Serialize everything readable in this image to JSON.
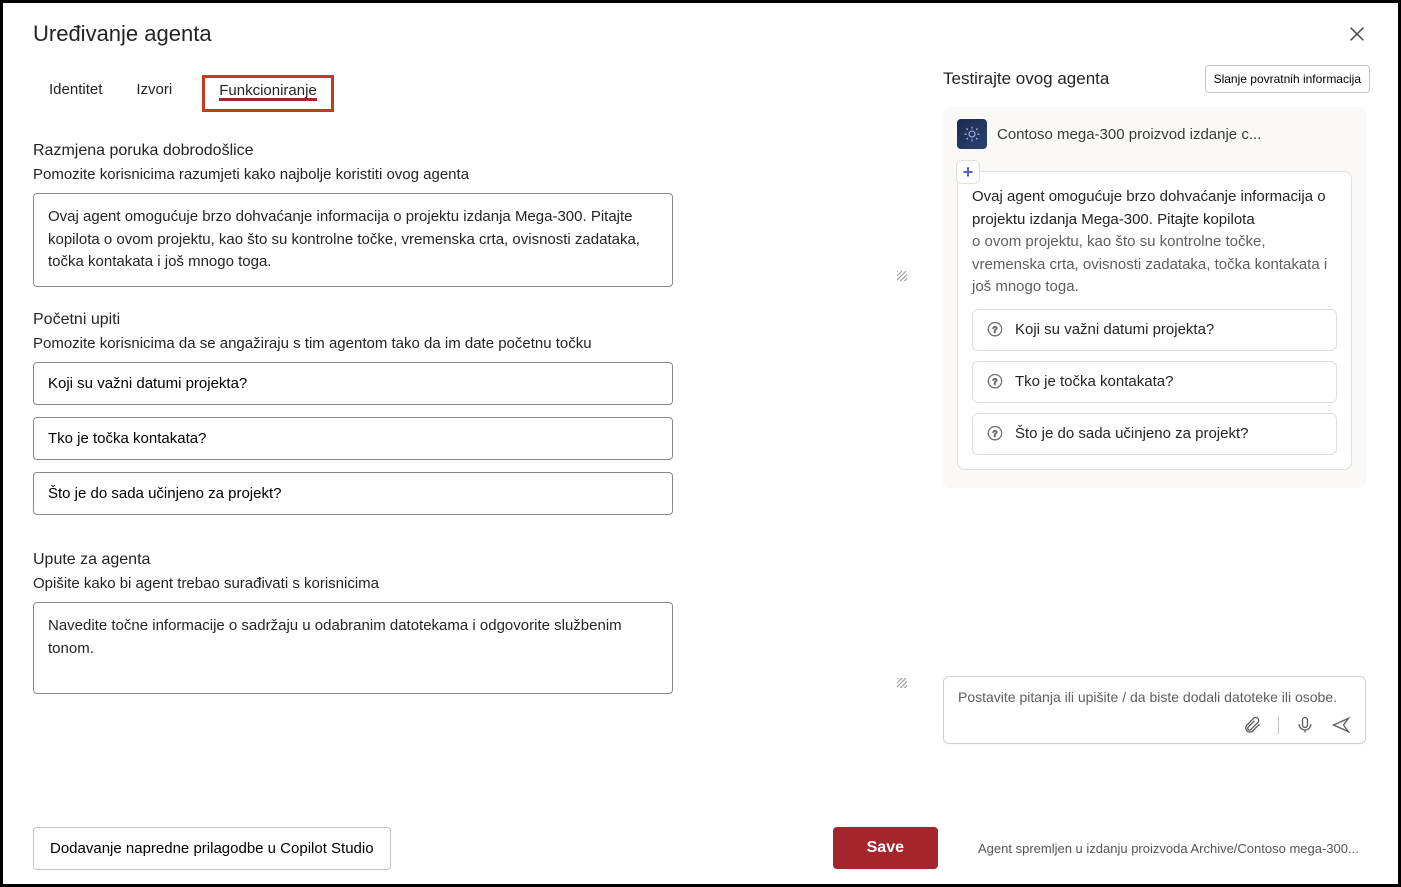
{
  "header": {
    "title": "Uređivanje agenta"
  },
  "tabs": {
    "items": [
      "Identitet",
      "Izvori",
      "Funkcioniranje"
    ],
    "active": 2
  },
  "welcome": {
    "section_title": "Razmjena poruka dobrodošlice",
    "section_sub": "Pomozite korisnicima razumjeti kako najbolje koristiti ovog agenta",
    "value": "Ovaj agent omogućuje brzo dohvaćanje informacija o projektu izdanja Mega-300. Pitajte kopilota o ovom projektu, kao što su kontrolne točke, vremenska crta, ovisnosti zadataka, točka kontakata i još mnogo toga."
  },
  "starter": {
    "section_title": "Početni upiti",
    "section_sub": "Pomozite korisnicima da se angažiraju s tim agentom tako da im date početnu točku",
    "prompts": [
      "Koji su važni datumi projekta?",
      "Tko je točka kontakata?",
      "Što je do sada učinjeno za projekt?"
    ]
  },
  "instructions": {
    "section_title": "Upute za agenta",
    "section_sub": "Opišite kako bi agent trebao surađivati s korisnicima",
    "value": "Navedite točne informacije o sadržaju u odabranim datotekama i odgovorite službenim tonom."
  },
  "footer": {
    "advanced": "Dodavanje napredne prilagodbe u Copilot Studio",
    "save": "Save",
    "status": "Agent spremljen u izdanju proizvoda Archive/Contoso mega-300..."
  },
  "preview": {
    "title": "Testirajte ovog agenta",
    "feedback": "Slanje povratnih informacija",
    "agent_name": "Contoso mega-300 proizvod izdanje c...",
    "intro_line1": "Ovaj agent omogućuje brzo dohvaćanje informacija o projektu izdanja Mega-300. Pitajte kopilota",
    "intro_line2": "o ovom projektu, kao što su kontrolne točke, vremenska crta, ovisnosti zadataka, točka kontakata i još mnogo toga.",
    "suggestions": [
      "Koji su važni datumi projekta?",
      "Tko je točka kontakata?",
      "Što je do sada učinjeno za projekt?"
    ],
    "input_placeholder": "Postavite pitanja ili upišite / da biste dodali datoteke ili osobe."
  }
}
